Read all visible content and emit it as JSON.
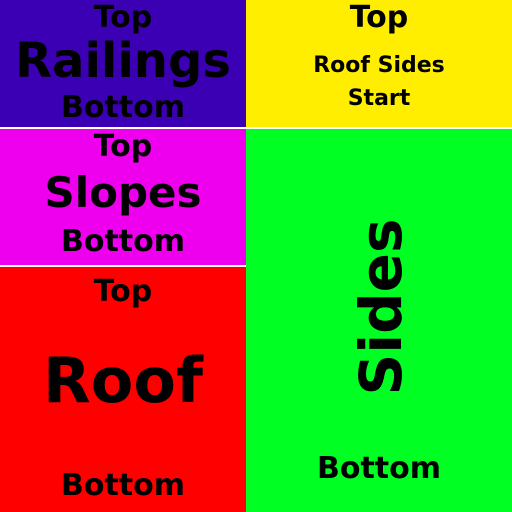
{
  "panels": {
    "railings": {
      "top": "Top",
      "title": "Railings",
      "bottom": "Bottom",
      "color": "#3c00b4"
    },
    "roof_sides": {
      "top": "Top",
      "line1": "Roof Sides",
      "line2": "Start",
      "color": "#ffee00"
    },
    "slopes": {
      "top": "Top",
      "title": "Slopes",
      "bottom": "Bottom",
      "color": "#ee00ee"
    },
    "roof": {
      "top": "Top",
      "title": "Roof",
      "bottom": "Bottom",
      "color": "#ff0000"
    },
    "sides": {
      "title": "Sides",
      "bottom": "Bottom",
      "color": "#00ff22"
    }
  },
  "separator_color": "#ffffff"
}
